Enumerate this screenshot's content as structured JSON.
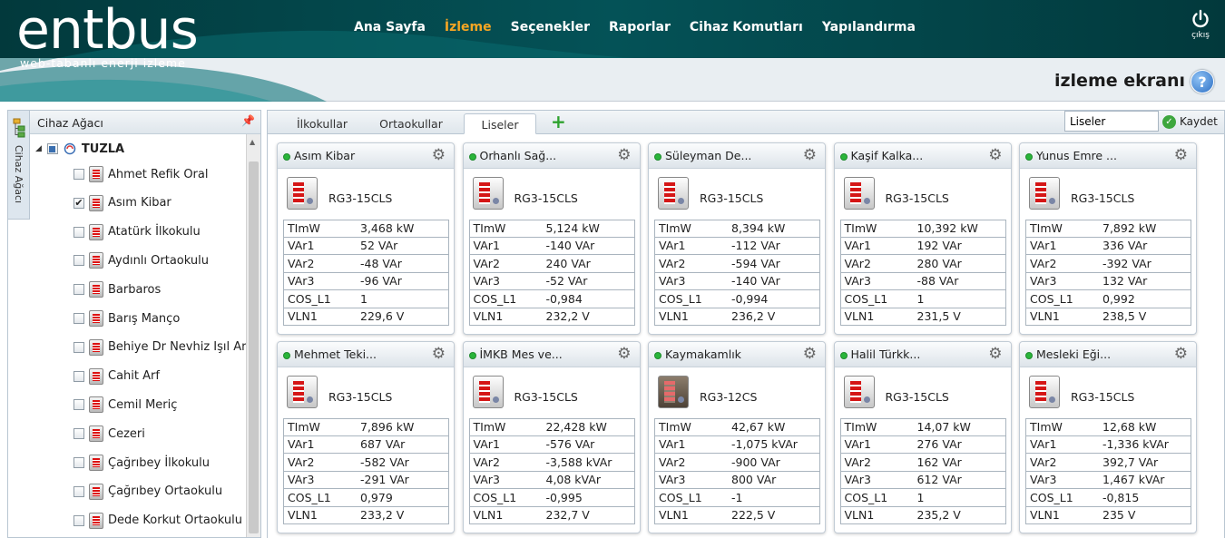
{
  "brand": {
    "logo": "entbus",
    "tagline": "web-tabanlı enerji izleme"
  },
  "nav": [
    "Ana Sayfa",
    "İzleme",
    "Seçenekler",
    "Raporlar",
    "Cihaz Komutları",
    "Yapılandırma"
  ],
  "exit_label": "çıkış",
  "page_title": "izleme ekranı",
  "help_icon": "?",
  "sidebar": {
    "strip_label": "Cihaz Ağacı",
    "title": "Cihaz Ağacı",
    "root": "TUZLA",
    "items": [
      {
        "label": "Ahmet Refik Oral",
        "checked": false
      },
      {
        "label": "Asım Kibar",
        "checked": true
      },
      {
        "label": "Atatürk İlkokulu",
        "checked": false
      },
      {
        "label": "Aydınlı Ortaokulu",
        "checked": false
      },
      {
        "label": "Barbaros",
        "checked": false
      },
      {
        "label": "Barış Manço",
        "checked": false
      },
      {
        "label": "Behiye Dr Nevhiz Işıl Ar",
        "checked": false
      },
      {
        "label": "Cahit Arf",
        "checked": false
      },
      {
        "label": "Cemil Meriç",
        "checked": false
      },
      {
        "label": "Cezeri",
        "checked": false
      },
      {
        "label": "Çağrıbey İlkokulu",
        "checked": false
      },
      {
        "label": "Çağrıbey Ortaokulu",
        "checked": false
      },
      {
        "label": "Dede Korkut Ortaokulu",
        "checked": false
      }
    ]
  },
  "tabs": {
    "items": [
      "İlkokullar",
      "Ortaokullar",
      "Liseler"
    ],
    "active": 2,
    "add_icon": "+"
  },
  "view_name": {
    "value": "Liseler",
    "placeholder": ""
  },
  "save_label": "Kaydet",
  "colors": {
    "status_online": "#29b53a",
    "active_nav": "#f5a623",
    "header_band": "#045257"
  },
  "cards": [
    {
      "title": "Asım Kibar",
      "model": "RG3-15CLS",
      "rows": [
        [
          "TImW",
          "3,468 kW"
        ],
        [
          "VAr1",
          "52 VAr"
        ],
        [
          "VAr2",
          "-48 VAr"
        ],
        [
          "VAr3",
          "-96 VAr"
        ],
        [
          "COS_L1",
          "1"
        ],
        [
          "VLN1",
          "229,6 V"
        ]
      ]
    },
    {
      "title": "Orhanlı Sağ...",
      "model": "RG3-15CLS",
      "rows": [
        [
          "TImW",
          "5,124 kW"
        ],
        [
          "VAr1",
          "-140 VAr"
        ],
        [
          "VAr2",
          "240 VAr"
        ],
        [
          "VAr3",
          "-52 VAr"
        ],
        [
          "COS_L1",
          "-0,984"
        ],
        [
          "VLN1",
          "232,2 V"
        ]
      ]
    },
    {
      "title": "Süleyman De...",
      "model": "RG3-15CLS",
      "rows": [
        [
          "TImW",
          "8,394 kW"
        ],
        [
          "VAr1",
          "-112 VAr"
        ],
        [
          "VAr2",
          "-594 VAr"
        ],
        [
          "VAr3",
          "-140 VAr"
        ],
        [
          "COS_L1",
          "-0,994"
        ],
        [
          "VLN1",
          "236,2 V"
        ]
      ]
    },
    {
      "title": "Kaşif Kalka...",
      "model": "RG3-15CLS",
      "rows": [
        [
          "TImW",
          "10,392 kW"
        ],
        [
          "VAr1",
          "192 VAr"
        ],
        [
          "VAr2",
          "280 VAr"
        ],
        [
          "VAr3",
          "-88 VAr"
        ],
        [
          "COS_L1",
          "1"
        ],
        [
          "VLN1",
          "231,5 V"
        ]
      ]
    },
    {
      "title": "Yunus Emre ...",
      "model": "RG3-15CLS",
      "rows": [
        [
          "TImW",
          "7,892 kW"
        ],
        [
          "VAr1",
          "336 VAr"
        ],
        [
          "VAr2",
          "-392 VAr"
        ],
        [
          "VAr3",
          "132 VAr"
        ],
        [
          "COS_L1",
          "0,992"
        ],
        [
          "VLN1",
          "238,5 V"
        ]
      ]
    },
    {
      "title": "Mehmet Teki...",
      "model": "RG3-15CLS",
      "rows": [
        [
          "TImW",
          "7,896 kW"
        ],
        [
          "VAr1",
          "687 VAr"
        ],
        [
          "VAr2",
          "-582 VAr"
        ],
        [
          "VAr3",
          "-291 VAr"
        ],
        [
          "COS_L1",
          "0,979"
        ],
        [
          "VLN1",
          "233,2 V"
        ]
      ]
    },
    {
      "title": "İMKB Mes ve...",
      "model": "RG3-15CLS",
      "rows": [
        [
          "TImW",
          "22,428 kW"
        ],
        [
          "VAr1",
          "-576 VAr"
        ],
        [
          "VAr2",
          "-3,588 kVAr"
        ],
        [
          "VAr3",
          "4,08 kVAr"
        ],
        [
          "COS_L1",
          "-0,995"
        ],
        [
          "VLN1",
          "232,7 V"
        ]
      ]
    },
    {
      "title": "Kaymakamlık",
      "model": "RG3-12CS",
      "alt": true,
      "rows": [
        [
          "TImW",
          "42,67 kW"
        ],
        [
          "VAr1",
          "-1,075 kVAr"
        ],
        [
          "VAr2",
          "-900 VAr"
        ],
        [
          "VAr3",
          "800 VAr"
        ],
        [
          "COS_L1",
          "-1"
        ],
        [
          "VLN1",
          "222,5 V"
        ]
      ]
    },
    {
      "title": "Halil Türkk...",
      "model": "RG3-15CLS",
      "rows": [
        [
          "TImW",
          "14,07 kW"
        ],
        [
          "VAr1",
          "276 VAr"
        ],
        [
          "VAr2",
          "162 VAr"
        ],
        [
          "VAr3",
          "612 VAr"
        ],
        [
          "COS_L1",
          "1"
        ],
        [
          "VLN1",
          "235,2 V"
        ]
      ]
    },
    {
      "title": "Mesleki Eği...",
      "model": "RG3-15CLS",
      "rows": [
        [
          "TImW",
          "12,68 kW"
        ],
        [
          "VAr1",
          "-1,336 kVAr"
        ],
        [
          "VAr2",
          "392,7 VAr"
        ],
        [
          "VAr3",
          "1,467 kVAr"
        ],
        [
          "COS_L1",
          "-0,815"
        ],
        [
          "VLN1",
          "235 V"
        ]
      ]
    }
  ]
}
